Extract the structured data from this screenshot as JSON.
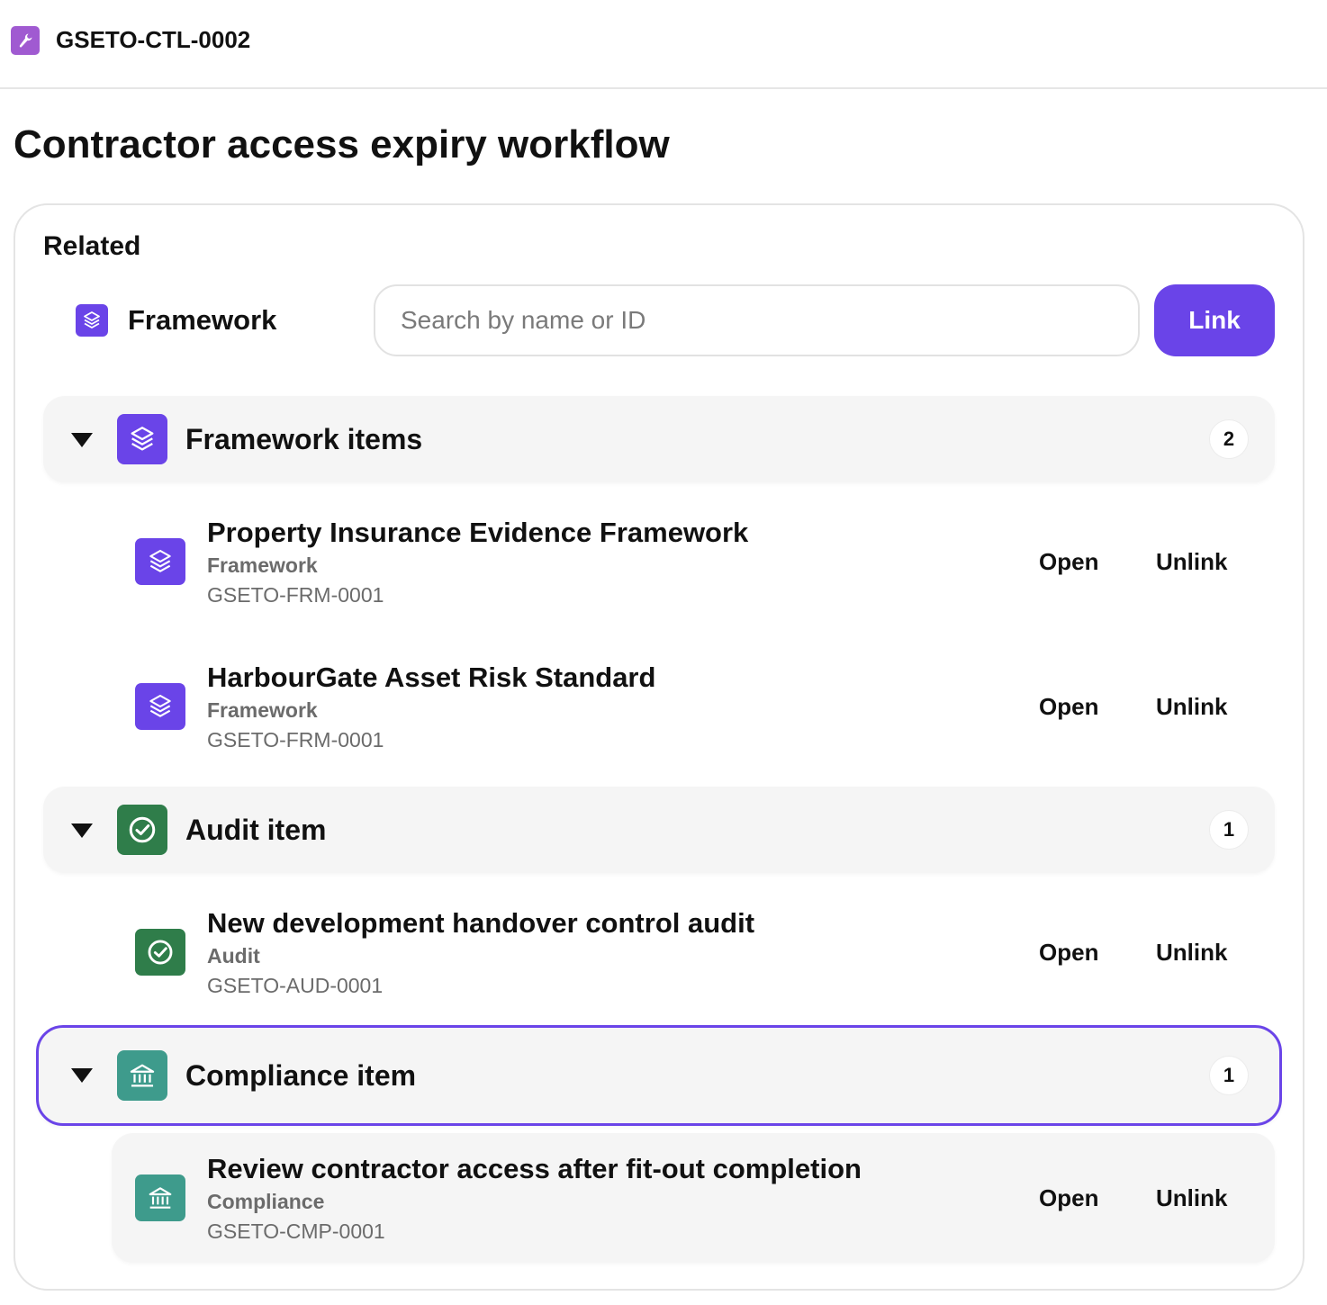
{
  "header": {
    "doc_id": "GSETO-CTL-0002",
    "icon": "wrench-icon",
    "icon_color": "#a05ad1"
  },
  "page": {
    "title": "Contractor access expiry workflow"
  },
  "related": {
    "heading": "Related",
    "type_selector": {
      "label": "Framework",
      "icon": "layers-icon"
    },
    "search": {
      "placeholder": "Search by name or ID",
      "value": ""
    },
    "link_label": "Link",
    "accent_color": "#6a44e8",
    "groups": [
      {
        "label": "Framework items",
        "count": "2",
        "icon": "layers-icon",
        "color": "#6a44e8",
        "expanded": true,
        "items": [
          {
            "title": "Property Insurance Evidence Framework",
            "type": "Framework",
            "id": "GSETO-FRM-0001",
            "open_label": "Open",
            "unlink_label": "Unlink"
          },
          {
            "title": "HarbourGate Asset Risk Standard",
            "type": "Framework",
            "id": "GSETO-FRM-0001",
            "open_label": "Open",
            "unlink_label": "Unlink"
          }
        ]
      },
      {
        "label": "Audit item",
        "count": "1",
        "icon": "check-circle-icon",
        "color": "#2f7d4a",
        "expanded": true,
        "items": [
          {
            "title": "New development handover control audit",
            "type": "Audit",
            "id": "GSETO-AUD-0001",
            "open_label": "Open",
            "unlink_label": "Unlink"
          }
        ]
      },
      {
        "label": "Compliance item",
        "count": "1",
        "icon": "bank-icon",
        "color": "#3e9b8c",
        "expanded": true,
        "selected": true,
        "items": [
          {
            "title": "Review contractor access after fit-out completion",
            "type": "Compliance",
            "id": "GSETO-CMP-0001",
            "open_label": "Open",
            "unlink_label": "Unlink"
          }
        ]
      }
    ]
  }
}
